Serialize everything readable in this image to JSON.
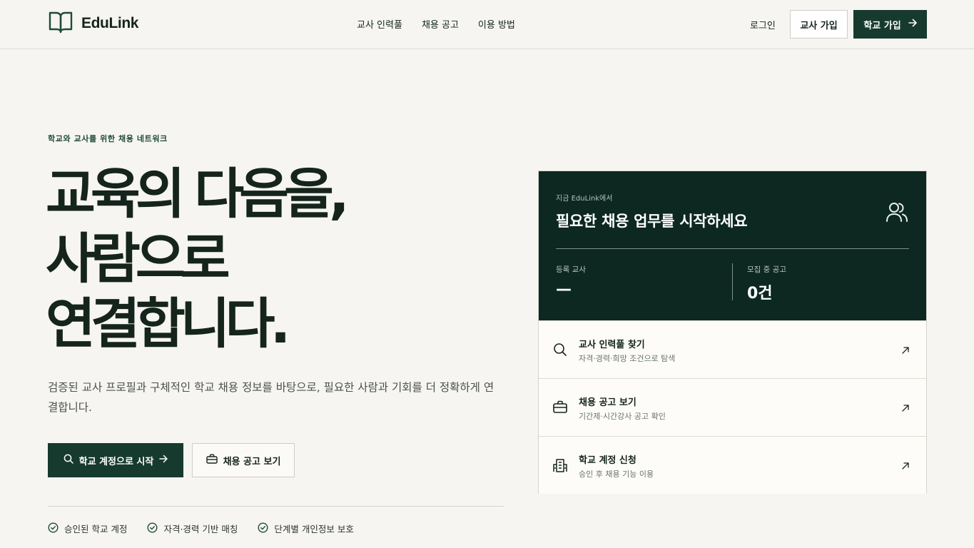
{
  "header": {
    "brand": "EduLink",
    "nav": [
      "교사 인력풀",
      "채용 공고",
      "이용 방법"
    ],
    "login": "로그인",
    "teacher_signup": "교사 가입",
    "school_signup": "학교 가입"
  },
  "hero": {
    "eyebrow": "학교와 교사를 위한 채용 네트워크",
    "title": "교육의 다음을,\n사람으로\n연결합니다.",
    "description": "검증된 교사 프로필과 구체적인 학교 채용 정보를 바탕으로, 필요한 사람과 기회를 더 정확하게 연결합니다.",
    "primary_cta": "학교 계정으로 시작",
    "secondary_cta": "채용 공고 보기",
    "features": [
      "승인된 학교 계정",
      "자격·경력 기반 매칭",
      "단계별 개인정보 보호"
    ]
  },
  "panel": {
    "kicker": "지금 EduLink에서",
    "title": "필요한 채용 업무를 시작하세요",
    "stats": [
      {
        "label": "등록 교사",
        "value": "—"
      },
      {
        "label": "모집 중 공고",
        "value": "0건"
      }
    ],
    "links": [
      {
        "title": "교사 인력풀 찾기",
        "subtitle": "자격·경력·희망 조건으로 탐색",
        "icon": "search-icon"
      },
      {
        "title": "채용 공고 보기",
        "subtitle": "기간제·시간강사 공고 확인",
        "icon": "briefcase-icon"
      },
      {
        "title": "학교 계정 신청",
        "subtitle": "승인 후 채용 기능 이용",
        "icon": "building-icon"
      }
    ]
  },
  "colors": {
    "primary": "#163a2e",
    "panel_dark": "#0c2820",
    "background": "#f6f5f1"
  }
}
